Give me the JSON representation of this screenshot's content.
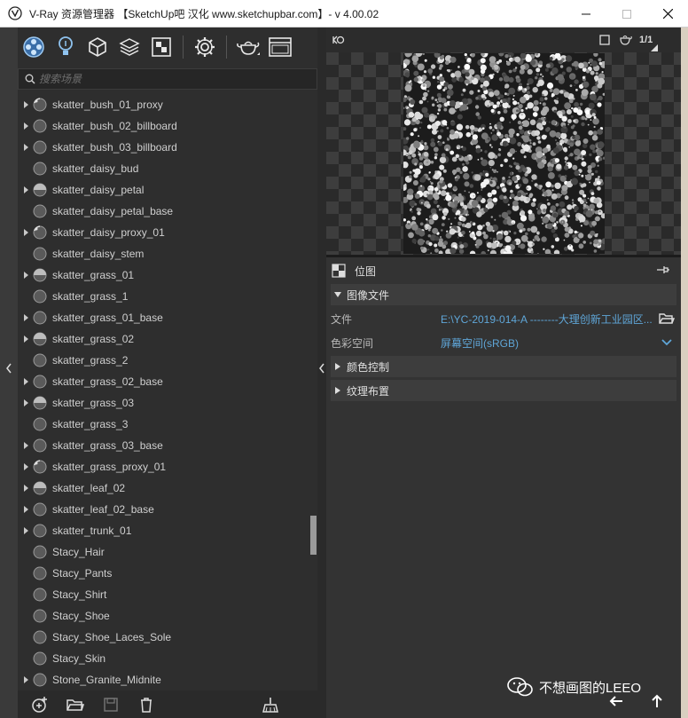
{
  "window": {
    "title": "V-Ray 资源管理器 【SketchUp吧 汉化 www.sketchupbar.com】- v 4.00.02"
  },
  "toolbar": {
    "icons": [
      "materials-icon",
      "lights-icon",
      "geometry-icon",
      "layers-icon",
      "textures-icon",
      "settings-icon",
      "render-teapot-icon",
      "frame-buffer-icon"
    ]
  },
  "search": {
    "placeholder": "搜索场景"
  },
  "materials": [
    {
      "name": "skatter_bush_01_proxy",
      "expandable": true,
      "icon": "proxy"
    },
    {
      "name": "skatter_bush_02_billboard",
      "expandable": true,
      "icon": "solid"
    },
    {
      "name": "skatter_bush_03_billboard",
      "expandable": true,
      "icon": "solid"
    },
    {
      "name": "skatter_daisy_bud",
      "expandable": false,
      "icon": "solid"
    },
    {
      "name": "skatter_daisy_petal",
      "expandable": true,
      "icon": "half"
    },
    {
      "name": "skatter_daisy_petal_base",
      "expandable": false,
      "icon": "solid"
    },
    {
      "name": "skatter_daisy_proxy_01",
      "expandable": true,
      "icon": "proxy"
    },
    {
      "name": "skatter_daisy_stem",
      "expandable": false,
      "icon": "solid"
    },
    {
      "name": "skatter_grass_01",
      "expandable": true,
      "icon": "half"
    },
    {
      "name": "skatter_grass_1",
      "expandable": false,
      "icon": "solid"
    },
    {
      "name": "skatter_grass_01_base",
      "expandable": true,
      "icon": "solid"
    },
    {
      "name": "skatter_grass_02",
      "expandable": true,
      "icon": "half"
    },
    {
      "name": "skatter_grass_2",
      "expandable": false,
      "icon": "solid"
    },
    {
      "name": "skatter_grass_02_base",
      "expandable": true,
      "icon": "solid"
    },
    {
      "name": "skatter_grass_03",
      "expandable": true,
      "icon": "half"
    },
    {
      "name": "skatter_grass_3",
      "expandable": false,
      "icon": "solid"
    },
    {
      "name": "skatter_grass_03_base",
      "expandable": true,
      "icon": "solid"
    },
    {
      "name": "skatter_grass_proxy_01",
      "expandable": true,
      "icon": "proxy"
    },
    {
      "name": "skatter_leaf_02",
      "expandable": true,
      "icon": "half"
    },
    {
      "name": "skatter_leaf_02_base",
      "expandable": true,
      "icon": "solid"
    },
    {
      "name": "skatter_trunk_01",
      "expandable": true,
      "icon": "solid"
    },
    {
      "name": "Stacy_Hair",
      "expandable": false,
      "icon": "solid"
    },
    {
      "name": "Stacy_Pants",
      "expandable": false,
      "icon": "solid"
    },
    {
      "name": "Stacy_Shirt",
      "expandable": false,
      "icon": "solid"
    },
    {
      "name": "Stacy_Shoe",
      "expandable": false,
      "icon": "solid"
    },
    {
      "name": "Stacy_Shoe_Laces_Sole",
      "expandable": false,
      "icon": "solid"
    },
    {
      "name": "Stacy_Skin",
      "expandable": false,
      "icon": "solid"
    },
    {
      "name": "Stone_Granite_Midnite",
      "expandable": true,
      "icon": "solid"
    }
  ],
  "preview": {
    "page_indicator": "1/1"
  },
  "properties": {
    "node_name": "位图",
    "sections": {
      "image_file": "图像文件",
      "color_control": "颜色控制",
      "texture_placement": "纹理布置"
    },
    "file_label": "文件",
    "file_value": "E:\\YC-2019-014-A --------大理创新工业园区...",
    "colorspace_label": "色彩空间",
    "colorspace_value": "屏幕空间(sRGB)"
  },
  "watermark": {
    "text": "不想画图的LEEO"
  },
  "colors": {
    "panel": "#2e2e2e",
    "accent_link": "#5fa6d8",
    "section_bg": "#3d3d3d"
  }
}
